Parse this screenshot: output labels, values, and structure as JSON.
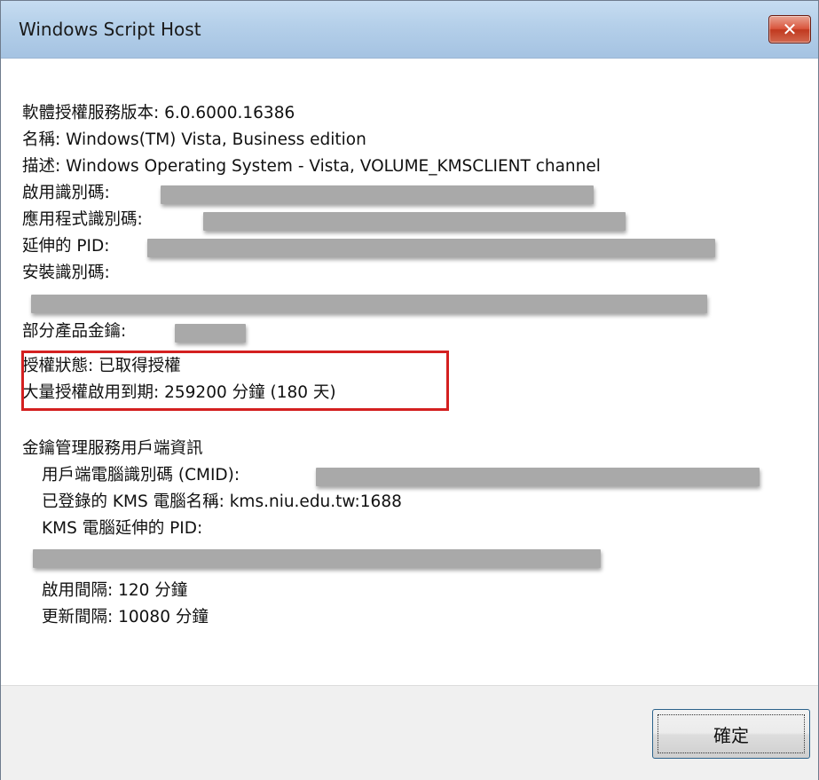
{
  "window": {
    "title": "Windows Script Host",
    "close_glyph": "✕"
  },
  "content": {
    "license_service_version": "軟體授權服務版本: 6.0.6000.16386",
    "name": "名稱: Windows(TM) Vista, Business edition",
    "description": "描述: Windows Operating System - Vista, VOLUME_KMSCLIENT channel",
    "activation_id_label": "啟用識別碼:",
    "application_id_label": "應用程式識別碼:",
    "extended_pid_label": "延伸的 PID:",
    "installation_id_label": "安裝識別碼:",
    "partial_product_key_label": "部分產品金鑰:",
    "license_status": "授權狀態: 已取得授權",
    "volume_activation_expiration": "大量授權啟用到期: 259200 分鐘 (180 天)",
    "kms_client_info_header": "金鑰管理服務用戶端資訊",
    "client_machine_id_label": "用戶端電腦識別碼 (CMID):",
    "registered_kms_machine": "已登錄的 KMS 電腦名稱: kms.niu.edu.tw:1688",
    "kms_extended_pid_label": "KMS 電腦延伸的 PID:",
    "activation_interval": "啟用間隔: 120 分鐘",
    "renewal_interval": "更新間隔: 10080 分鐘"
  },
  "footer": {
    "ok_label": "確定"
  },
  "colors": {
    "titlebar": "#b4cfe9",
    "highlight_border": "#d42020",
    "redaction": "#a9a9a9",
    "close_button": "#d9553c"
  }
}
